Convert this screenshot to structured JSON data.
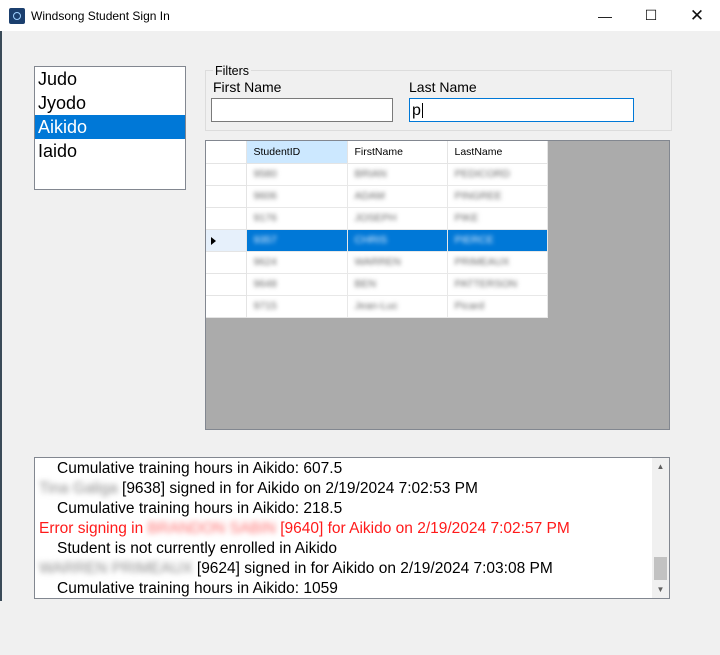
{
  "window": {
    "title": "Windsong Student Sign In",
    "min_glyph": "—",
    "max_glyph": "☐",
    "close_glyph": "✕"
  },
  "arts": {
    "items": [
      {
        "label": "Judo"
      },
      {
        "label": "Jyodo"
      },
      {
        "label": "Aikido",
        "selected": true
      },
      {
        "label": "Iaido"
      }
    ]
  },
  "filters": {
    "legend": "Filters",
    "first_name_label": "First Name",
    "first_name_value": "",
    "last_name_label": "Last Name",
    "last_name_value": "p"
  },
  "grid": {
    "columns": [
      "StudentID",
      "FirstName",
      "LastName"
    ],
    "rows": [
      [
        "9580",
        "BRIAN",
        "PEDICORD"
      ],
      [
        "9606",
        "ADAM",
        "PINGREE"
      ],
      [
        "9176",
        "JOSEPH",
        "PIKE"
      ],
      [
        "9357",
        "CHRIS",
        "PIERCE"
      ],
      [
        "9624",
        "WARREN",
        "PRIMEAUX"
      ],
      [
        "9648",
        "BEN",
        "PATTERSON"
      ],
      [
        "9715",
        "Jean-Luc",
        "Picard"
      ]
    ],
    "selected_row": 3
  },
  "log": {
    "lines": [
      {
        "indent": true,
        "text": "Cumulative training hours in Aikido: 607.5"
      },
      {
        "name": "Tina Galiga",
        "text": " [9638] signed in for Aikido on 2/19/2024 7:02:53 PM"
      },
      {
        "indent": true,
        "text": "Cumulative training hours in Aikido: 218.5"
      },
      {
        "error": true,
        "prefix": "Error signing in ",
        "name": "BRANDON SABIN",
        "text": " [9640] for Aikido on 2/19/2024 7:02:57 PM"
      },
      {
        "indent": true,
        "text": "Student is not currently enrolled in Aikido"
      },
      {
        "name": "WARREN PRIMEAUX",
        "text": " [9624] signed in for Aikido on 2/19/2024 7:03:08 PM"
      },
      {
        "indent": true,
        "text": "Cumulative training hours in Aikido: 1059"
      }
    ]
  }
}
